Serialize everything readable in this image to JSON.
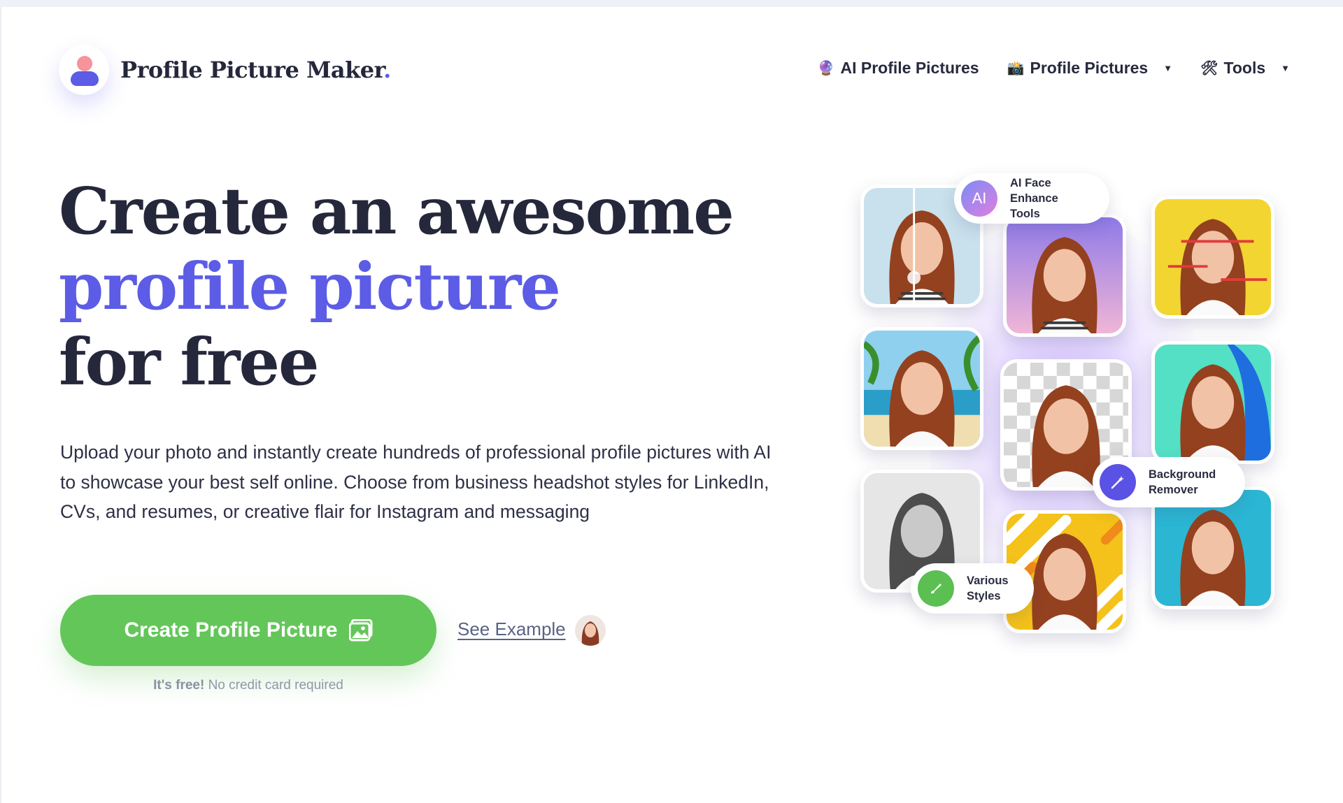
{
  "brand": {
    "name": "Profile Picture Maker",
    "dot": ".",
    "logo_icon": "person-avatar-icon"
  },
  "nav": {
    "items": [
      {
        "icon": "crystal-ball-icon",
        "glyph": "🔮",
        "label": "AI Profile Pictures",
        "has_caret": false
      },
      {
        "icon": "camera-flash-icon",
        "glyph": "📸",
        "label": "Profile Pictures",
        "has_caret": true
      },
      {
        "icon": "tools-icon",
        "glyph": "🛠",
        "label": "Tools",
        "has_caret": true
      }
    ],
    "caret_glyph": "▼"
  },
  "hero": {
    "headline_line1": "Create an awesome",
    "headline_line2": "profile picture",
    "headline_line3": "for free",
    "description": "Upload your photo and instantly create hundreds of professional profile pictures with AI to showcase your best self online. Choose from business headshot styles for LinkedIn, CVs, and resumes, or creative flair for Instagram and messaging",
    "cta_label": "Create Profile Picture",
    "see_example": "See Example",
    "free_bold": "It's free!",
    "free_rest": " No credit card required"
  },
  "features": {
    "ai_face": {
      "badge": "AI",
      "label": "AI Face\nEnhance Tools"
    },
    "background": {
      "label": "Background\nRemover",
      "icon": "magic-wand-icon"
    },
    "styles": {
      "label": "Various\nStyles",
      "icon": "paintbrush-icon"
    }
  },
  "colors": {
    "accent": "#5c5ce6",
    "cta": "#63c659",
    "text": "#25273b"
  }
}
